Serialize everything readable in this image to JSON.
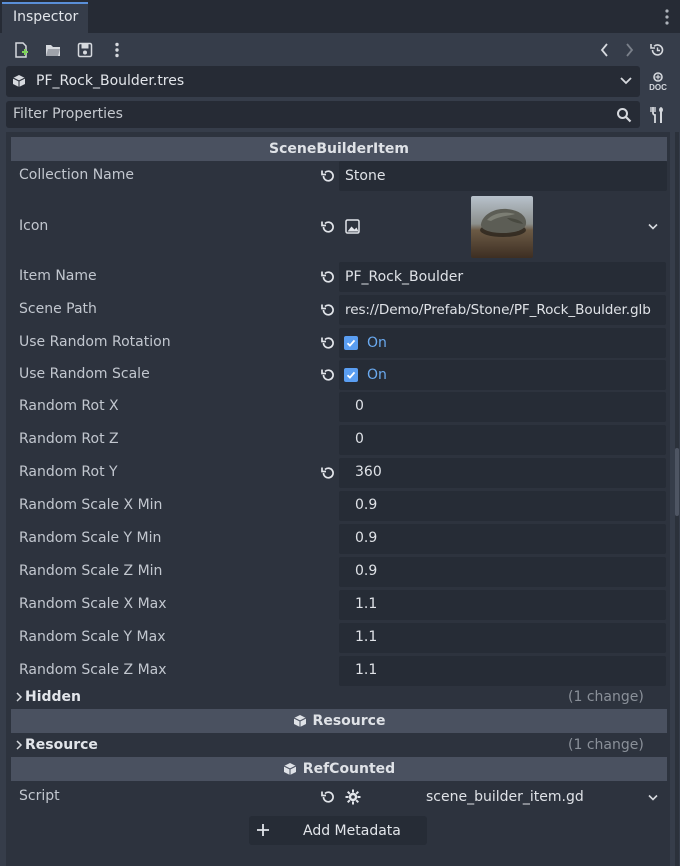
{
  "tab": {
    "title": "Inspector"
  },
  "toolbar": {
    "icons": [
      "new-resource-icon",
      "open-folder-icon",
      "save-icon",
      "kebab-menu-icon",
      "back-icon",
      "forward-icon",
      "history-icon"
    ]
  },
  "resource": {
    "name": "PF_Rock_Boulder.tres",
    "doc_label": "DOC"
  },
  "filter": {
    "placeholder": "Filter Properties"
  },
  "sections": {
    "scene_builder_item": "SceneBuilderItem",
    "resource": "Resource",
    "refcounted": "RefCounted"
  },
  "properties": {
    "collection_name": {
      "label": "Collection Name",
      "value": "Stone"
    },
    "icon": {
      "label": "Icon"
    },
    "item_name": {
      "label": "Item Name",
      "value": "PF_Rock_Boulder"
    },
    "scene_path": {
      "label": "Scene Path",
      "value": "res://Demo/Prefab/Stone/PF_Rock_Boulder.glb"
    },
    "use_random_rotation": {
      "label": "Use Random Rotation",
      "value": "On",
      "checked": true
    },
    "use_random_scale": {
      "label": "Use Random Scale",
      "value": "On",
      "checked": true
    },
    "random_rot_x": {
      "label": "Random Rot X",
      "value": "0"
    },
    "random_rot_z": {
      "label": "Random Rot Z",
      "value": "0"
    },
    "random_rot_y": {
      "label": "Random Rot Y",
      "value": "360"
    },
    "random_scale_x_min": {
      "label": "Random Scale X Min",
      "value": "0.9"
    },
    "random_scale_y_min": {
      "label": "Random Scale Y Min",
      "value": "0.9"
    },
    "random_scale_z_min": {
      "label": "Random Scale Z Min",
      "value": "0.9"
    },
    "random_scale_x_max": {
      "label": "Random Scale X Max",
      "value": "1.1"
    },
    "random_scale_y_max": {
      "label": "Random Scale Y Max",
      "value": "1.1"
    },
    "random_scale_z_max": {
      "label": "Random Scale Z Max",
      "value": "1.1"
    }
  },
  "groups": {
    "hidden": {
      "label": "Hidden",
      "changes": "(1 change)"
    },
    "resource": {
      "label": "Resource",
      "changes": "(1 change)"
    }
  },
  "script": {
    "label": "Script",
    "value": "scene_builder_item.gd"
  },
  "add_metadata": {
    "label": "Add Metadata"
  },
  "colors": {
    "accent": "#5a9ef2",
    "background": "#363d4a",
    "section": "#4a5160"
  }
}
